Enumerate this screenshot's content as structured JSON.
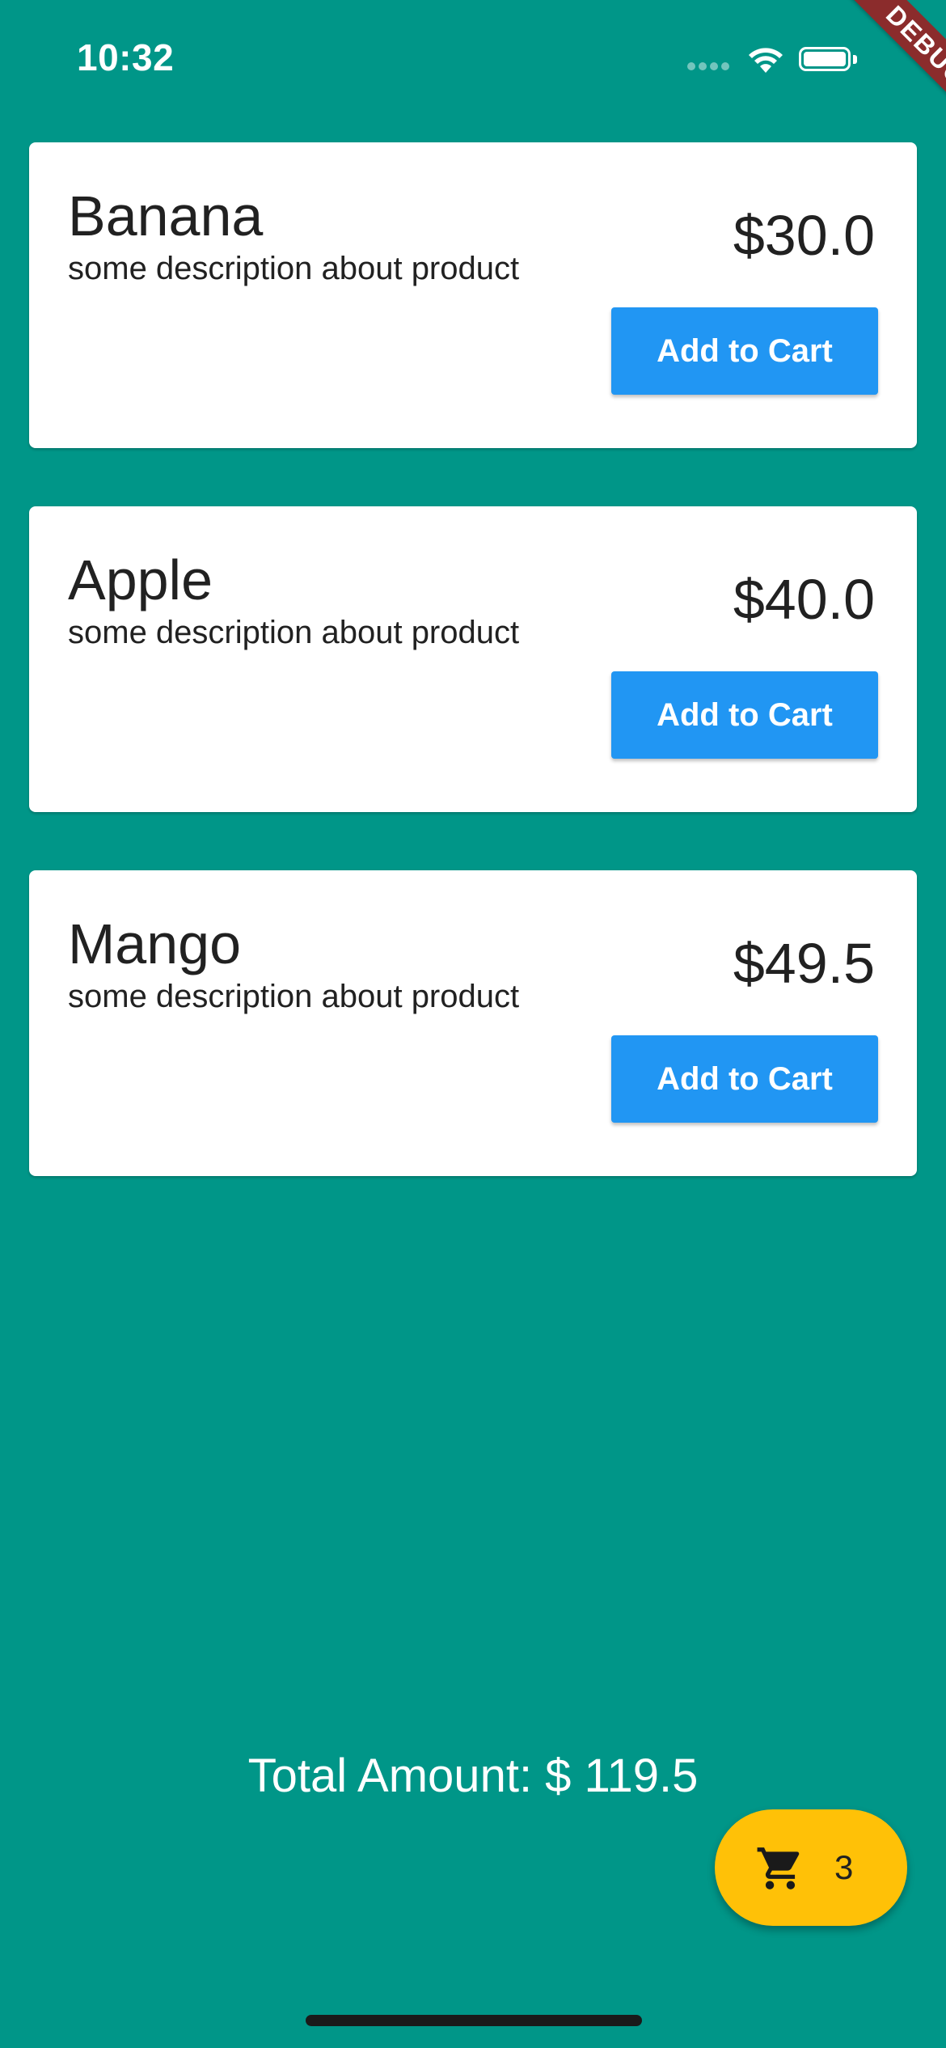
{
  "status_bar": {
    "time": "10:32"
  },
  "debug_banner": {
    "label": "DEBUG"
  },
  "products": [
    {
      "name": "Banana",
      "description": "some description about product",
      "price": "$30.0",
      "button_label": "Add to Cart"
    },
    {
      "name": "Apple",
      "description": "some description about product",
      "price": "$40.0",
      "button_label": "Add to Cart"
    },
    {
      "name": "Mango",
      "description": "some description about product",
      "price": "$49.5",
      "button_label": "Add to Cart"
    }
  ],
  "total": {
    "text": "Total Amount: $ 119.5"
  },
  "cart": {
    "count": "3",
    "icon": "shopping-cart-icon"
  },
  "colors": {
    "background": "#009688",
    "card": "#ffffff",
    "button": "#2196f3",
    "fab": "#ffc107",
    "debug_banner": "#8b2c2c"
  }
}
